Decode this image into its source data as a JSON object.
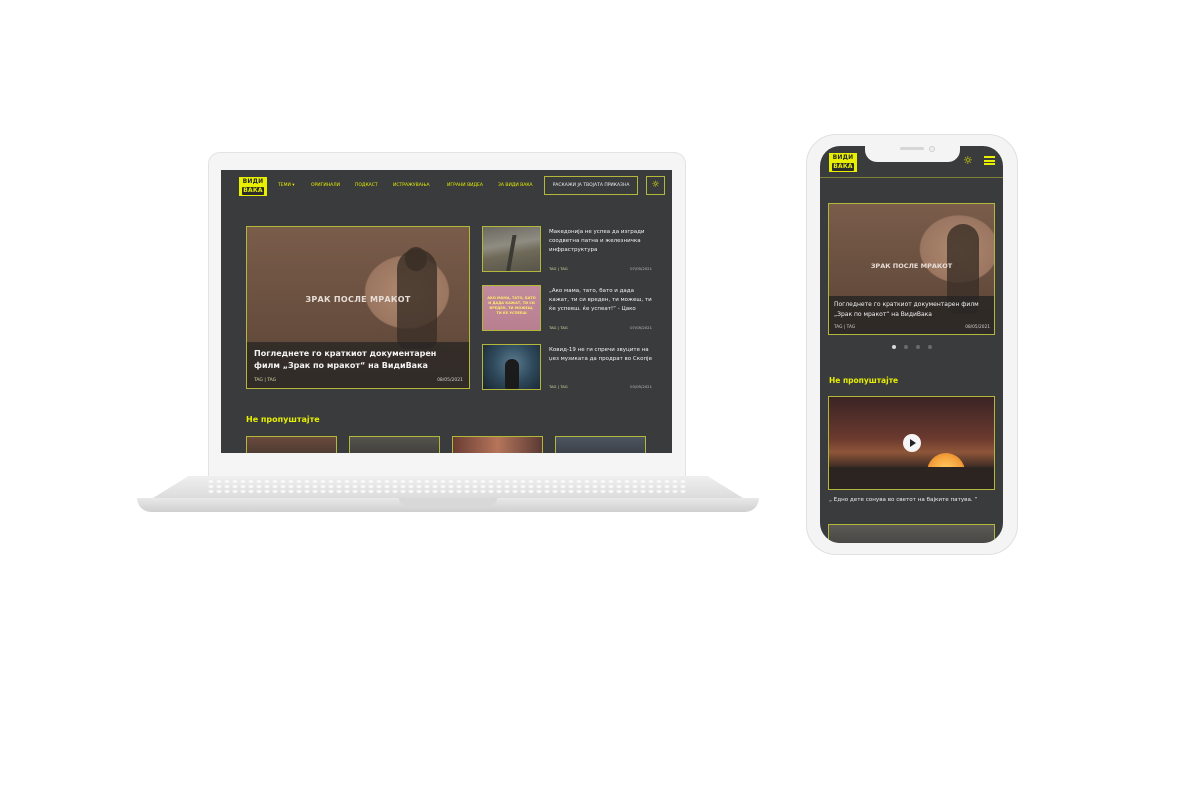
{
  "desktop": {
    "logo": {
      "line1": "ВИДИ",
      "line2": "ВАКА"
    },
    "nav": [
      "ТЕМИ ▾",
      "ОРИГИНАЛИ",
      "ПОДКАСТ",
      "ИСТРАЖУВАЊА",
      "ИГРАНИ ВИДЕА",
      "ЗА ВИДИ ВАКА"
    ],
    "cta": "РАСКАЖИ ЈА ТВОЈАТА ПРИКАЗНА",
    "theme_icon": "☼",
    "hero": {
      "stamp": "ЗРАК ПОСЛЕ МРАКОТ",
      "title": "Погледнете го краткиот документарен филм „Зрак по мракот“ на ВидиВака",
      "tag1": "TAG",
      "tag2": "TAG",
      "date": "08/05/2021"
    },
    "side": [
      {
        "title": "Македонија не успеа да изгради соодветна патна и железничка инфраструктура",
        "tags": "TAG | TAG",
        "date": "07/05/2021"
      },
      {
        "title": "„Ако мама, тато, бато и дада кажат, ти си вреден, ти можеш, ти ќе успееш. ќе успеат!“ - Цако",
        "tags": "TAG | TAG",
        "date": "07/05/2021",
        "poster_text": "АКО МАМА, ТАТО, БАТО И ДАДА КАЖАТ, ТИ СИ ВРЕДЕН, ТИ МОЖЕШ, ТИ ЌЕ УСПЕЕШ"
      },
      {
        "title": "Ковид-19 не ги спречи звуците на џез музиката да продрат во Скопје",
        "tags": "TAG | TAG",
        "date": "03/05/2021"
      }
    ],
    "section_title": "Не пропуштајте"
  },
  "mobile": {
    "logo": {
      "line1": "ВИДИ",
      "line2": "ВАКА"
    },
    "theme_icon": "☼",
    "hero": {
      "stamp": "ЗРАК ПОСЛЕ МРАКОТ",
      "title": "Погледнете го краткиот документарен филм „Зрак по мракот“ на ВидиВака",
      "tags": "TAG  |  TAG",
      "date": "08/05/2021"
    },
    "section_title": "Не пропуштајте",
    "video_caption": "„ Едно дете сонува во светот на бајките патува. “"
  }
}
